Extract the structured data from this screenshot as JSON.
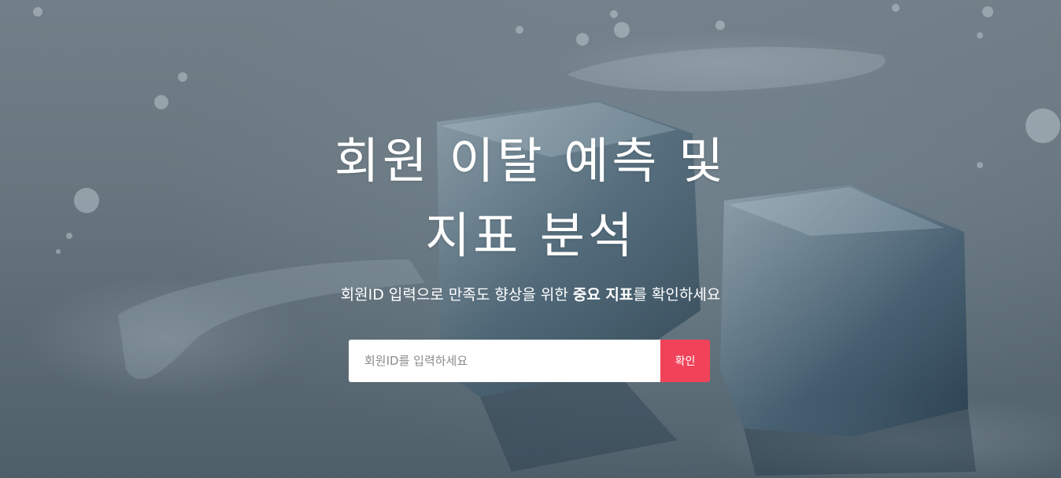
{
  "hero": {
    "title_line1": "회원 이탈 예측 및",
    "title_line2": "지표 분석",
    "subtitle_before": "회원ID 입력으로 만족도 향상을 위한 ",
    "subtitle_bold": "중요 지표",
    "subtitle_after": "를 확인하세요"
  },
  "search": {
    "placeholder": "회원ID를 입력하세요",
    "value": "",
    "button_label": "확인"
  },
  "colors": {
    "accent": "#f0435a",
    "overlay": "#6a7780",
    "text": "#ffffff"
  },
  "background": {
    "image": "ice-cubes-photo"
  }
}
